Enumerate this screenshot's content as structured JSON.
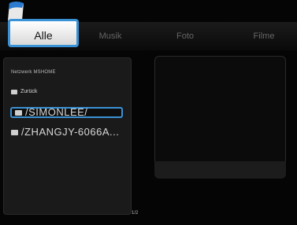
{
  "tabs": [
    {
      "label": "Alle"
    },
    {
      "label": "Musik"
    },
    {
      "label": "Foto"
    },
    {
      "label": "Filme"
    }
  ],
  "browser": {
    "path": "Netzwerk  MSHOME",
    "items": [
      {
        "label": "Zurück"
      },
      {
        "label": "/SIMONLEE/"
      },
      {
        "label": "/ZHANGJY-6066A..."
      }
    ],
    "page": "1/2"
  },
  "colors": {
    "accent": "#3a92d6",
    "background": "#050505"
  }
}
